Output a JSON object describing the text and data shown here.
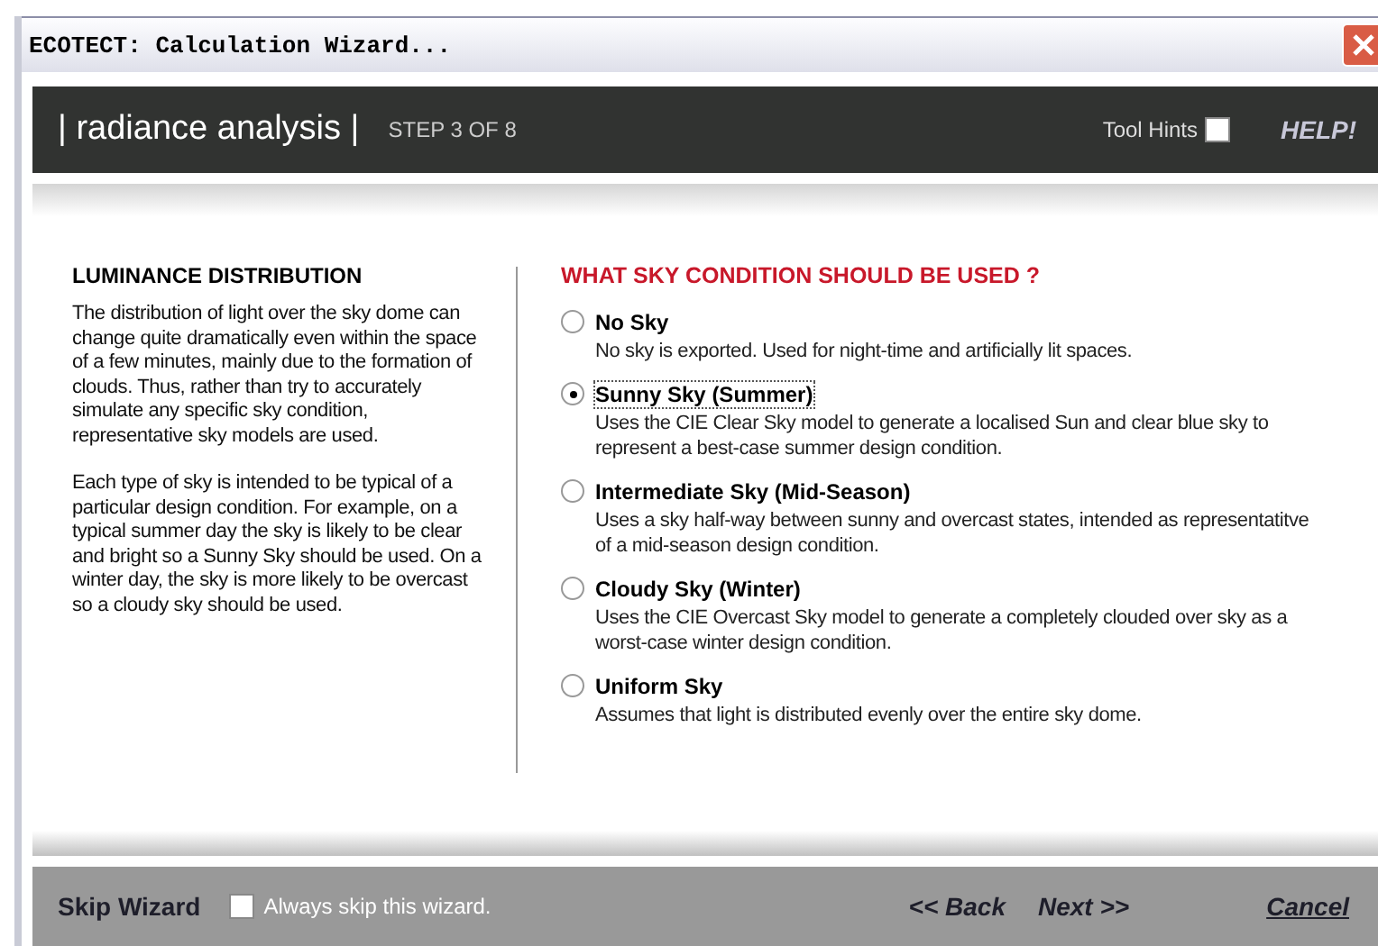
{
  "window": {
    "title": "ECOTECT: Calculation Wizard..."
  },
  "header": {
    "title": "| radiance analysis |",
    "step": "STEP 3 OF 8",
    "tool_hints": {
      "label": "Tool Hints",
      "checked": false
    },
    "help": "HELP!"
  },
  "left_panel": {
    "heading": "LUMINANCE DISTRIBUTION",
    "paragraphs": [
      "The distribution of light over the sky dome can change quite dramatically even within the space of a few minutes, mainly due to the formation of clouds. Thus, rather than try to accurately simulate any specific sky condition, representative sky models are used.",
      "Each type of sky is intended to be typical of a particular design condition.  For example, on a typical summer day the sky is likely to be clear and bright so a Sunny Sky should be used.  On a winter day, the sky is more likely to be overcast so a cloudy sky should be used."
    ]
  },
  "question": "WHAT SKY CONDITION SHOULD BE USED ?",
  "options": [
    {
      "label": "No Sky",
      "description": "No sky is exported.  Used for night-time and artificially lit spaces.",
      "selected": false
    },
    {
      "label": "Sunny Sky  (Summer)",
      "description": "Uses the CIE Clear Sky model to generate a localised Sun and clear blue sky to represent a best-case summer design condition.",
      "selected": true
    },
    {
      "label": "Intermediate Sky  (Mid-Season)",
      "description": "Uses a sky half-way between sunny and overcast states, intended as representatitve of a mid-season design condition.",
      "selected": false
    },
    {
      "label": "Cloudy Sky  (Winter)",
      "description": "Uses the CIE Overcast Sky model to generate a completely clouded over sky as a worst-case winter design condition.",
      "selected": false
    },
    {
      "label": "Uniform Sky",
      "description": "Assumes that light is distributed evenly over the entire sky dome.",
      "selected": false
    }
  ],
  "footer": {
    "skip_label": "Skip Wizard",
    "always_skip": {
      "label": "Always skip this wizard.",
      "checked": false
    },
    "back": "<< Back",
    "next": "Next >>",
    "cancel": "Cancel"
  }
}
